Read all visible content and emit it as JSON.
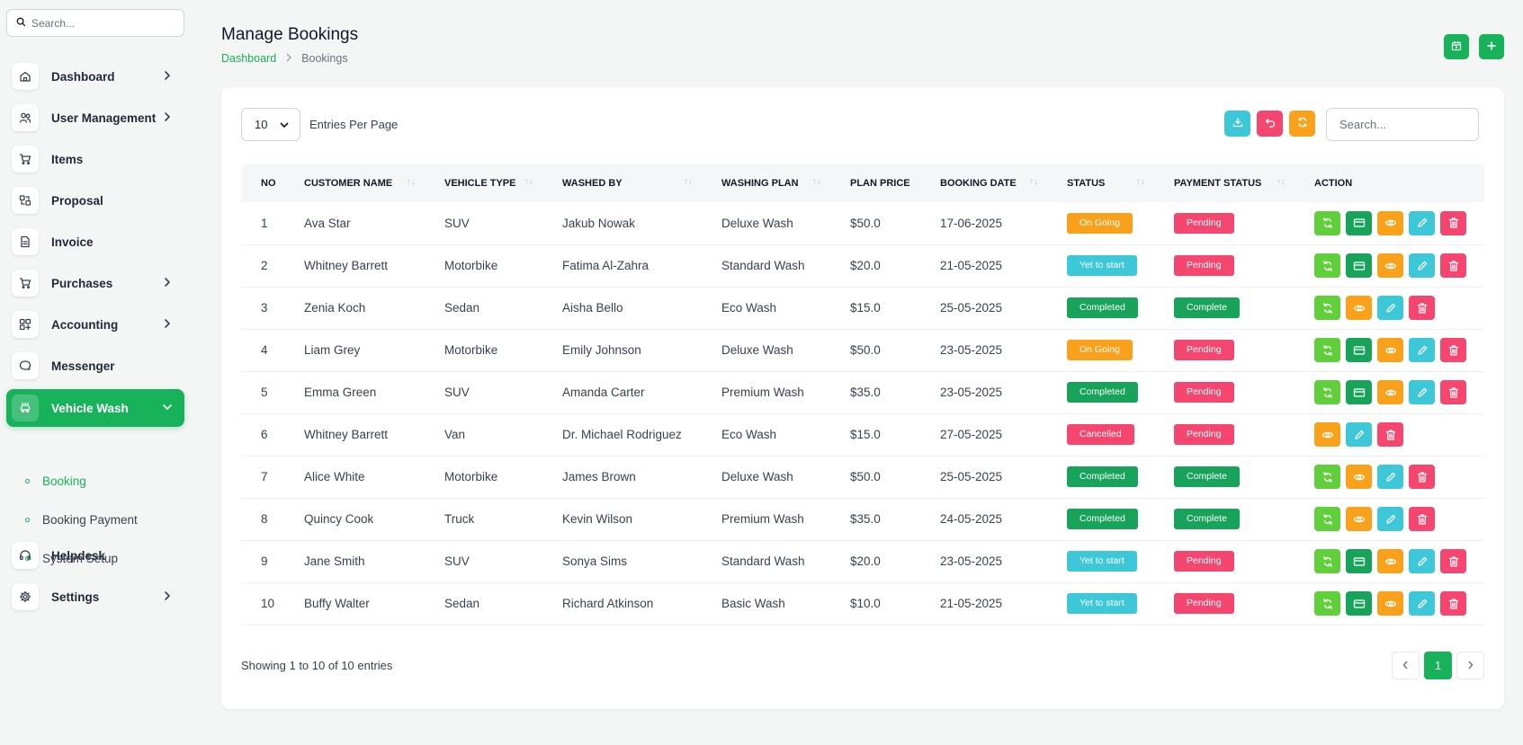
{
  "sidebar": {
    "search_placeholder": "Search...",
    "items": [
      {
        "label": "Dashboard",
        "icon": "home-icon",
        "has_chevron": true
      },
      {
        "label": "User Management",
        "icon": "users-icon",
        "has_chevron": true
      },
      {
        "label": "Items",
        "icon": "cart-icon",
        "has_chevron": false
      },
      {
        "label": "Proposal",
        "icon": "proposal-icon",
        "has_chevron": false
      },
      {
        "label": "Invoice",
        "icon": "file-icon",
        "has_chevron": false
      },
      {
        "label": "Purchases",
        "icon": "cart-icon",
        "has_chevron": true
      },
      {
        "label": "Accounting",
        "icon": "grid-plus-icon",
        "has_chevron": true
      },
      {
        "label": "Messenger",
        "icon": "chat-icon",
        "has_chevron": false
      },
      {
        "label": "Vehicle Wash",
        "icon": "car-wash-icon",
        "has_chevron": true,
        "active": true
      },
      {
        "label": "Helpdesk",
        "icon": "headset-icon",
        "has_chevron": false
      },
      {
        "label": "Settings",
        "icon": "gear-icon",
        "has_chevron": true
      }
    ],
    "sub_items": [
      {
        "label": "Booking",
        "active": true
      },
      {
        "label": "Booking Payment",
        "active": false
      },
      {
        "label": "System Setup",
        "active": false
      }
    ]
  },
  "header": {
    "title": "Manage Bookings",
    "breadcrumb_home": "Dashboard",
    "breadcrumb_current": "Bookings"
  },
  "toolbar": {
    "entries_value": "10",
    "entries_label": "Entries Per Page",
    "search_placeholder": "Search..."
  },
  "table": {
    "columns": [
      "NO",
      "CUSTOMER NAME",
      "VEHICLE TYPE",
      "WASHED BY",
      "WASHING PLAN",
      "PLAN PRICE",
      "BOOKING DATE",
      "STATUS",
      "PAYMENT STATUS",
      "ACTION"
    ],
    "rows": [
      {
        "no": "1",
        "customer": "Ava Star",
        "vehicle": "SUV",
        "washed_by": "Jakub Nowak",
        "plan": "Deluxe Wash",
        "price": "$50.0",
        "date": "17-06-2025",
        "status": "On Going",
        "payment": "Pending",
        "actions": [
          "sync",
          "card",
          "view",
          "edit",
          "delete"
        ]
      },
      {
        "no": "2",
        "customer": "Whitney Barrett",
        "vehicle": "Motorbike",
        "washed_by": "Fatima Al-Zahra",
        "plan": "Standard Wash",
        "price": "$20.0",
        "date": "21-05-2025",
        "status": "Yet to start",
        "payment": "Pending",
        "actions": [
          "sync",
          "card",
          "view",
          "edit",
          "delete"
        ]
      },
      {
        "no": "3",
        "customer": "Zenia Koch",
        "vehicle": "Sedan",
        "washed_by": "Aisha Bello",
        "plan": "Eco Wash",
        "price": "$15.0",
        "date": "25-05-2025",
        "status": "Completed",
        "payment": "Complete",
        "actions": [
          "sync",
          "view",
          "edit",
          "delete"
        ]
      },
      {
        "no": "4",
        "customer": "Liam Grey",
        "vehicle": "Motorbike",
        "washed_by": "Emily Johnson",
        "plan": "Deluxe Wash",
        "price": "$50.0",
        "date": "23-05-2025",
        "status": "On Going",
        "payment": "Pending",
        "actions": [
          "sync",
          "card",
          "view",
          "edit",
          "delete"
        ]
      },
      {
        "no": "5",
        "customer": "Emma Green",
        "vehicle": "SUV",
        "washed_by": "Amanda Carter",
        "plan": "Premium Wash",
        "price": "$35.0",
        "date": "23-05-2025",
        "status": "Completed",
        "payment": "Pending",
        "actions": [
          "sync",
          "card",
          "view",
          "edit",
          "delete"
        ]
      },
      {
        "no": "6",
        "customer": "Whitney Barrett",
        "vehicle": "Van",
        "washed_by": "Dr. Michael Rodriguez",
        "plan": "Eco Wash",
        "price": "$15.0",
        "date": "27-05-2025",
        "status": "Cancelled",
        "payment": "Pending",
        "actions": [
          "view",
          "edit",
          "delete"
        ]
      },
      {
        "no": "7",
        "customer": "Alice White",
        "vehicle": "Motorbike",
        "washed_by": "James Brown",
        "plan": "Deluxe Wash",
        "price": "$50.0",
        "date": "25-05-2025",
        "status": "Completed",
        "payment": "Complete",
        "actions": [
          "sync",
          "view",
          "edit",
          "delete"
        ]
      },
      {
        "no": "8",
        "customer": "Quincy Cook",
        "vehicle": "Truck",
        "washed_by": "Kevin Wilson",
        "plan": "Premium Wash",
        "price": "$35.0",
        "date": "24-05-2025",
        "status": "Completed",
        "payment": "Complete",
        "actions": [
          "sync",
          "view",
          "edit",
          "delete"
        ]
      },
      {
        "no": "9",
        "customer": "Jane Smith",
        "vehicle": "SUV",
        "washed_by": "Sonya Sims",
        "plan": "Standard Wash",
        "price": "$20.0",
        "date": "23-05-2025",
        "status": "Yet to start",
        "payment": "Pending",
        "actions": [
          "sync",
          "card",
          "view",
          "edit",
          "delete"
        ]
      },
      {
        "no": "10",
        "customer": "Buffy Walter",
        "vehicle": "Sedan",
        "washed_by": "Richard Atkinson",
        "plan": "Basic Wash",
        "price": "$10.0",
        "date": "21-05-2025",
        "status": "Yet to start",
        "payment": "Pending",
        "actions": [
          "sync",
          "card",
          "view",
          "edit",
          "delete"
        ]
      }
    ]
  },
  "footer": {
    "showing": "Showing 1 to 10 of 10 entries",
    "current_page": "1"
  },
  "colors": {
    "primary": "#17b25a",
    "on_going": "#f9a11b",
    "yet_to_start": "#3cc8d8",
    "completed": "#17a45a",
    "cancelled": "#f4466e",
    "pending": "#f4466e",
    "complete": "#17a45a",
    "sync": "#5fcf3a",
    "card": "#17a45a",
    "view": "#f9a11b",
    "edit": "#3cc8d8",
    "delete": "#f4466e"
  }
}
